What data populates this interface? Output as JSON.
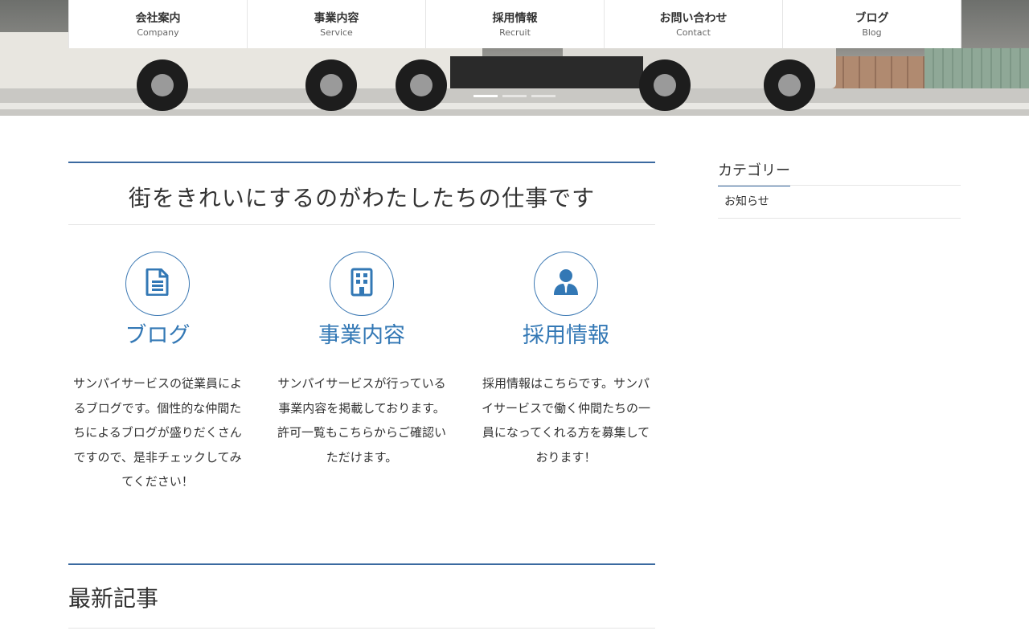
{
  "nav": {
    "items": [
      {
        "label": "会社案内",
        "sub": "Company"
      },
      {
        "label": "事業内容",
        "sub": "Service"
      },
      {
        "label": "採用情報",
        "sub": "Recruit"
      },
      {
        "label": "お問い合わせ",
        "sub": "Contact"
      },
      {
        "label": "ブログ",
        "sub": "Blog"
      }
    ]
  },
  "hero": {
    "slides_total": 3,
    "active_slide": 1
  },
  "main": {
    "title": "街をきれいにするのがわたしたちの仕事です",
    "features": [
      {
        "icon": "document-icon",
        "title": "ブログ",
        "text": "サンパイサービスの従業員によるブログです。個性的な仲間たちによるブログが盛りだくさんですので、是非チェックしてみてください！"
      },
      {
        "icon": "building-icon",
        "title": "事業内容",
        "text": "サンパイサービスが行っている事業内容を掲載しております。許可一覧もこちらからご確認いただけます。"
      },
      {
        "icon": "person-icon",
        "title": "採用情報",
        "text": "採用情報はこちらです。サンパイサービスで働く仲間たちの一員になってくれる方を募集しております！"
      }
    ],
    "recent_title": "最新記事"
  },
  "sidebar": {
    "heading": "カテゴリー",
    "categories": [
      "お知らせ"
    ]
  },
  "colors": {
    "accent": "#3378b5",
    "rule": "#3b6aa0"
  }
}
